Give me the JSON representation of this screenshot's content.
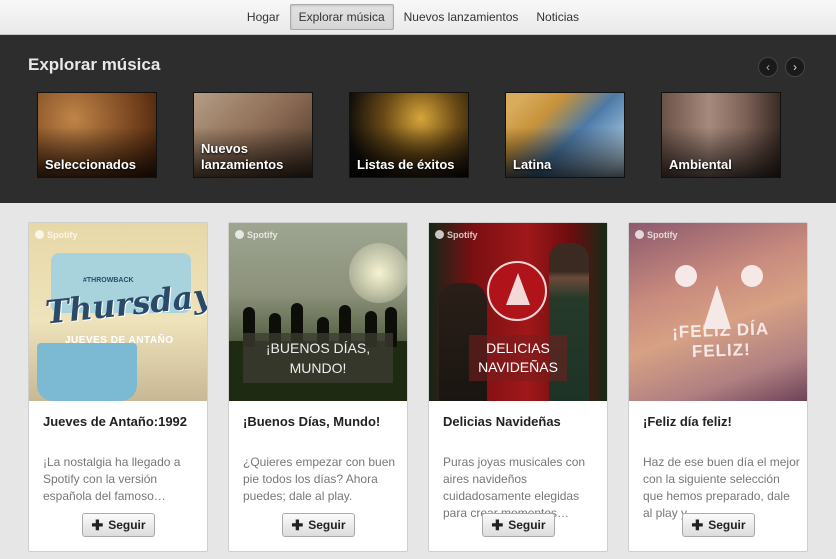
{
  "tabs": [
    {
      "label": "Hogar",
      "active": false
    },
    {
      "label": "Explorar música",
      "active": true
    },
    {
      "label": "Nuevos lanzamientos",
      "active": false
    },
    {
      "label": "Noticias",
      "active": false
    }
  ],
  "explore": {
    "title": "Explorar música",
    "prev_icon": "chevron-left",
    "next_icon": "chevron-right",
    "categories": [
      {
        "label": "Seleccionados"
      },
      {
        "label": "Nuevos lanzamientos"
      },
      {
        "label": "Listas de éxitos"
      },
      {
        "label": "Latina"
      },
      {
        "label": "Ambiental"
      }
    ]
  },
  "playlists": [
    {
      "brand": "Spotify",
      "art_text_main": "Thursday",
      "art_text_small": "#THROWBACK",
      "art_text_sub": "JUEVES DE ANTAÑO",
      "title": "Jueves de Antaño:1992",
      "description": "¡La nostalgia ha llegado a Spotify con la versión española del famoso…",
      "follow_label": "Seguir"
    },
    {
      "brand": "Spotify",
      "art_text": "¡BUENOS DÍAS, MUNDO!",
      "title": "¡Buenos Días, Mundo!",
      "description": "¿Quieres empezar con buen pie todos los días? Ahora puedes; dale al play.",
      "follow_label": "Seguir"
    },
    {
      "brand": "Spotify",
      "art_text": "DELICIAS NAVIDEÑAS",
      "title": "Delicias Navideñas",
      "description": "Puras joyas musicales con aires navideños cuidadosamente elegidas para crear momentos…",
      "follow_label": "Seguir"
    },
    {
      "brand": "Spotify",
      "art_text": "¡FELIZ DÍA FELIZ!",
      "title": "¡Feliz día feliz!",
      "description": "Haz de ese buen día el mejor con la siguiente selección que hemos preparado, dale al play y…",
      "follow_label": "Seguir"
    }
  ]
}
